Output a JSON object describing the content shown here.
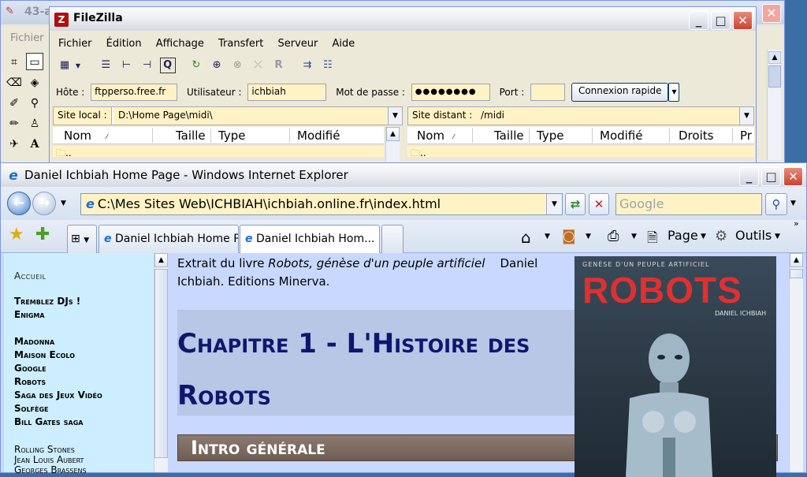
{
  "paint": {
    "title": "43-a",
    "menu_first": "Fichier",
    "close": "✕"
  },
  "filezilla": {
    "title": "FileZilla",
    "menu": [
      "Fichier",
      "Édition",
      "Affichage",
      "Transfert",
      "Serveur",
      "Aide"
    ],
    "quickconnect": {
      "host_label": "Hôte :",
      "host_value": "ftpperso.free.fr",
      "user_label": "Utilisateur :",
      "user_value": "ichbiah",
      "pass_label": "Mot de passe :",
      "pass_value": "●●●●●●●●",
      "port_label": "Port :",
      "port_value": "",
      "connect_button": "Connexion rapide"
    },
    "local": {
      "label": "Site local :",
      "path": "D:\\Home Page\\midi\\",
      "columns": [
        "Nom",
        "Taille",
        "Type",
        "Modifié"
      ],
      "first_row": ".."
    },
    "remote": {
      "label": "Site distant :",
      "path": "/midi",
      "columns": [
        "Nom",
        "Taille",
        "Type",
        "Modifié",
        "Droits",
        "Pr"
      ],
      "first_row": ".."
    }
  },
  "ie": {
    "title": "Daniel Ichbiah Home Page - Windows Internet Explorer",
    "address": "C:\\Mes Sites Web\\ICHBIAH\\ichbiah.online.fr\\index.html",
    "search_placeholder": "Google",
    "tabs": [
      {
        "label": "Daniel Ichbiah Home P..."
      },
      {
        "label": "Daniel Ichbiah Hom..."
      }
    ],
    "commands": {
      "page": "Page",
      "tools": "Outils"
    },
    "nav": {
      "home": "Accueil",
      "group1": [
        "Tremblez DJs !",
        "Enigma"
      ],
      "group2": [
        "Madonna",
        "Maison Ecolo",
        "Google",
        "Robots",
        "Saga des Jeux Vidéo",
        "Solfège",
        "Bill Gates saga"
      ],
      "group3": [
        "Rolling Stones",
        "Jean Louis Aubert",
        "Georges Brassens"
      ]
    },
    "page": {
      "intro_prefix": "Extrait du livre ",
      "intro_book": "Robots, génèse d'un peuple artificiel",
      "intro_suffix": "Daniel Ichbiah. Editions Minerva.",
      "chapter_title": "Chapitre 1 - L'Histoire des Robots",
      "section_title": "Intro générale",
      "cover_subtitle": "GENÈSE D'UN PEUPLE ARTIFICIEL",
      "cover_title": "ROBOTS",
      "cover_author": "DANIEL ICHBIAH"
    }
  },
  "colors": {
    "input_bg": "#fff3c6",
    "page_bg": "#c8d8ff",
    "nav_bg": "#cdeeff",
    "chapter_text": "#0f1670",
    "cover_red": "#e03030"
  }
}
